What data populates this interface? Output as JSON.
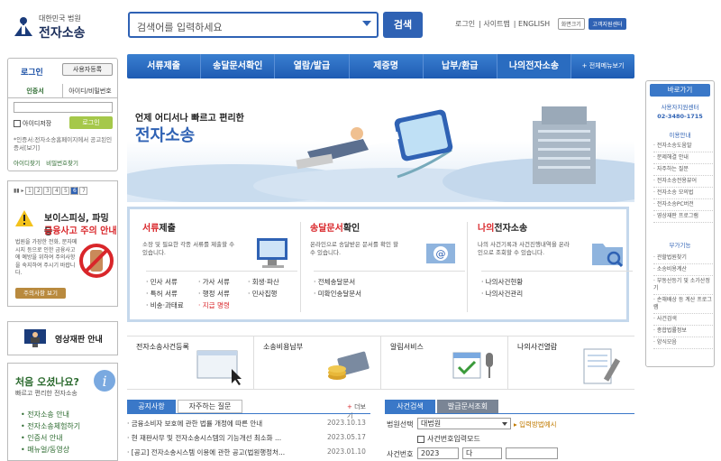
{
  "header": {
    "logo_top": "대한민국 법원",
    "logo_name": "전자소송",
    "search_placeholder": "검색어를 입력하세요",
    "search_button": "검색",
    "util_login": "로그인",
    "util_sitemap": "사이트맵",
    "util_english": "ENGLISH",
    "util_zoom": "화면크기",
    "util_center": "고객지원센터"
  },
  "gnb": {
    "items": [
      "서류제출",
      "송달문서확인",
      "열람/발급",
      "제증명",
      "납부/환급",
      "나의전자소송"
    ],
    "all_menu": "+ 전체메뉴보기"
  },
  "login": {
    "title": "로그인",
    "register": "사용자등록",
    "tab_cert": "인증서",
    "tab_id": "아이디/비밀번호",
    "save_id": "아이디저장",
    "login_button": "로그인",
    "note": "*인증서:전자소송홈페이지에서 공고된인증서[보기]",
    "find_id": "아이디찾기",
    "find_pw": "비밀번호찾기"
  },
  "notice_banner": {
    "pages": [
      "1",
      "2",
      "3",
      "4",
      "5",
      "6",
      "7"
    ],
    "active_page": "6",
    "headline1": "보이스피싱, 파밍 등",
    "headline2": "금융사고 주의 안내",
    "text": "법원을 가장한 전화, 문자메시지 등으로 인한 금융사고에 예방을 위하여 주의사항을 숙지하여 주시기 바랍니다.",
    "more": "주의사항 보기"
  },
  "video": {
    "label": "영상재판 안내"
  },
  "first_visit": {
    "title": "처음 오셨나요?",
    "subtitle": "빠르고 편리한 전자소송",
    "links": [
      "전자소송 안내",
      "전자소송체험하기",
      "인증서 안내",
      "매뉴얼/동영상"
    ]
  },
  "visual": {
    "line1": "언제 어디서나 빠르고 편리한",
    "line2": "전자소송"
  },
  "services": [
    {
      "title_em": "서류",
      "title_rest": "제출",
      "desc": "소장 및 필요한 각종 서류를 제출할 수 있습니다.",
      "items": [
        "· 민사 서류",
        "· 가사 서류",
        "· 회생·파산",
        "· 특허 서류",
        "· 행정 서류",
        "· 민사집행",
        "· 비송·과태료",
        "· 지급 명령"
      ]
    },
    {
      "title_em": "송달문서",
      "title_rest": "확인",
      "desc": "온라인으로 송달받은 문서를 확인 할 수 있습니다.",
      "items": [
        "· 전체송달문서",
        "· 미확인송달문서"
      ]
    },
    {
      "title_em": "나의",
      "title_rest": "전자소송",
      "desc": "나의 사건기록과 사건진행내역을 온라인으로 조회할 수 있습니다.",
      "items": [
        "· 나의사건현황",
        "· 나의사건관리"
      ]
    }
  ],
  "quick": [
    "전자소송사건등록",
    "소송비용납부",
    "알림서비스",
    "나의사건열람"
  ],
  "news": {
    "tab_notice": "공지사항",
    "tab_faq": "자주하는 질문",
    "more": "더보기",
    "rows": [
      {
        "title": "· 금융소비자 보호에 관한 법률 개정에 따른 안내",
        "date": "2023.10.13"
      },
      {
        "title": "· 현 재판사무 및 전자소송시스템의 기능개선 최소화 ...",
        "date": "2023.05.17"
      },
      {
        "title": "· [공고] 전자소송시스템 이용에 관한 공고(법원행정처...",
        "date": "2023.01.10"
      }
    ]
  },
  "case_search": {
    "tab_search": "사건검색",
    "tab_issue": "발급문서조회",
    "court_label": "법원선택",
    "court_value": "대법원",
    "how": "입력방법예시",
    "checkbox": "사건번호입력모드",
    "case_label": "사건번호",
    "year": "2023",
    "kind": "다"
  },
  "right_bar": {
    "title": "바로가기",
    "center": "사용자지원센터",
    "phone": "02-3480-1715",
    "group1": "이용안내",
    "items1": [
      "전자소송도움말",
      "문제해결 안내",
      "자주하는 질문",
      "전자소송전용뷰어",
      "전자소송 모의법",
      "전자소송PC버전",
      "영상재판 프로그램"
    ],
    "group2": "부가기능",
    "items2": [
      "관할법원찾기",
      "소송비용계산",
      "부동산등기 및 소가산정기",
      "손해배상 등 계산 프로그램",
      "사건검색",
      "종합법률정보",
      "양식모음"
    ]
  }
}
